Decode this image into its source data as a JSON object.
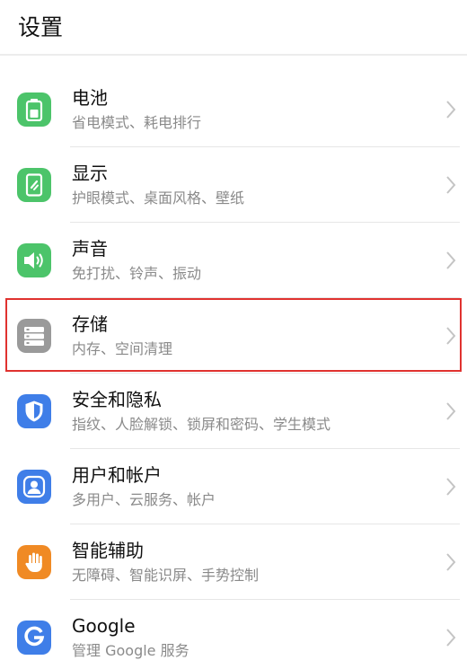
{
  "header": {
    "title": "设置"
  },
  "items": [
    {
      "title": "电池",
      "subtitle": "省电模式、耗电排行",
      "icon": "battery-icon",
      "color": "#4cc46a"
    },
    {
      "title": "显示",
      "subtitle": "护眼模式、桌面风格、壁纸",
      "icon": "display-icon",
      "color": "#4cc46a"
    },
    {
      "title": "声音",
      "subtitle": "免打扰、铃声、振动",
      "icon": "speaker-icon",
      "color": "#4cc46a"
    },
    {
      "title": "存储",
      "subtitle": "内存、空间清理",
      "icon": "storage-icon",
      "color": "#9a9a9a"
    },
    {
      "title": "安全和隐私",
      "subtitle": "指纹、人脸解锁、锁屏和密码、学生模式",
      "icon": "shield-icon",
      "color": "#3f7ee8"
    },
    {
      "title": "用户和帐户",
      "subtitle": "多用户、云服务、帐户",
      "icon": "user-icon",
      "color": "#3f7ee8"
    },
    {
      "title": "智能辅助",
      "subtitle": "无障碍、智能识屏、手势控制",
      "icon": "hand-icon",
      "color": "#f08a24"
    },
    {
      "title": "Google",
      "subtitle": "管理 Google 服务",
      "icon": "google-icon",
      "color": "#3f7ee8"
    }
  ],
  "highlight_color": "#e0322f"
}
